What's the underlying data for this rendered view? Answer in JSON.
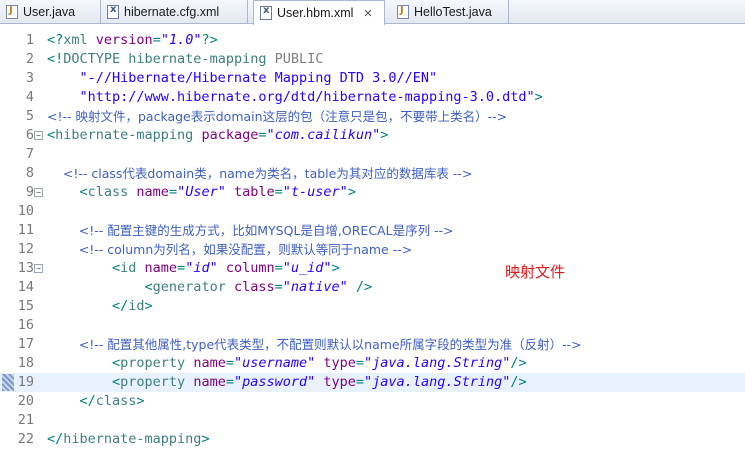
{
  "tabs": [
    {
      "label": "User.java",
      "icon": "java-file-icon"
    },
    {
      "label": "hibernate.cfg.xml",
      "icon": "xml-file-icon"
    },
    {
      "label": "User.hbm.xml",
      "icon": "xml-file-icon",
      "active": true,
      "close_glyph": "✕"
    },
    {
      "label": "HelloTest.java",
      "icon": "java-file-icon"
    }
  ],
  "editor": {
    "current_line": 19,
    "lines": [
      {
        "n": "1",
        "segs": [
          [
            "p",
            "<?"
          ],
          [
            "t",
            "xml "
          ],
          [
            "a",
            "version"
          ],
          [
            "p",
            "="
          ],
          [
            "v",
            "\"1.0\""
          ],
          [
            "p",
            "?>"
          ]
        ]
      },
      {
        "n": "2",
        "segs": [
          [
            "p",
            "<!"
          ],
          [
            "t",
            "DOCTYPE hibernate-mapping "
          ],
          [
            "d",
            "PUBLIC"
          ]
        ]
      },
      {
        "n": "3",
        "segs": [
          [
            "s",
            "    \"-//Hibernate/Hibernate Mapping DTD 3.0//EN\""
          ]
        ]
      },
      {
        "n": "4",
        "segs": [
          [
            "s",
            "    \"http://www.hibernate.org/dtd/hibernate-mapping-3.0.dtd\""
          ],
          [
            "p",
            ">"
          ]
        ]
      },
      {
        "n": "5",
        "segs": [
          [
            "c",
            "<!-- 映射文件，package表示domain这层的包（注意只是包，不要带上类名）-->"
          ]
        ]
      },
      {
        "n": "6",
        "fold": true,
        "segs": [
          [
            "p",
            "<"
          ],
          [
            "t",
            "hibernate-mapping "
          ],
          [
            "a",
            "package"
          ],
          [
            "p",
            "="
          ],
          [
            "v",
            "\"com.cailikun\""
          ],
          [
            "p",
            ">"
          ]
        ]
      },
      {
        "n": "7",
        "segs": []
      },
      {
        "n": "8",
        "segs": [
          [
            "c",
            "    <!-- class代表domain类，name为类名，table为其对应的数据库表 -->"
          ]
        ]
      },
      {
        "n": "9",
        "fold": true,
        "segs": [
          [
            "p",
            "    <"
          ],
          [
            "t",
            "class "
          ],
          [
            "a",
            "name"
          ],
          [
            "p",
            "="
          ],
          [
            "v",
            "\"User\""
          ],
          [
            "t",
            " "
          ],
          [
            "a",
            "table"
          ],
          [
            "p",
            "="
          ],
          [
            "v",
            "\"t-user\""
          ],
          [
            "p",
            ">"
          ]
        ]
      },
      {
        "n": "10",
        "segs": []
      },
      {
        "n": "11",
        "segs": [
          [
            "c",
            "        <!-- 配置主键的生成方式，比如MYSQL是自增,ORECAL是序列 -->"
          ]
        ]
      },
      {
        "n": "12",
        "segs": [
          [
            "c",
            "        <!-- column为列名，如果没配置，则默认等同于name -->"
          ]
        ]
      },
      {
        "n": "13",
        "fold": true,
        "segs": [
          [
            "p",
            "        <"
          ],
          [
            "t",
            "id "
          ],
          [
            "a",
            "name"
          ],
          [
            "p",
            "="
          ],
          [
            "v",
            "\"id\""
          ],
          [
            "t",
            " "
          ],
          [
            "a",
            "column"
          ],
          [
            "p",
            "="
          ],
          [
            "v",
            "\"u_id\""
          ],
          [
            "p",
            ">"
          ]
        ]
      },
      {
        "n": "14",
        "segs": [
          [
            "p",
            "            <"
          ],
          [
            "t",
            "generator "
          ],
          [
            "a",
            "class"
          ],
          [
            "p",
            "="
          ],
          [
            "v",
            "\"native\""
          ],
          [
            "t",
            " "
          ],
          [
            "p",
            "/>"
          ]
        ]
      },
      {
        "n": "15",
        "segs": [
          [
            "p",
            "        </"
          ],
          [
            "t",
            "id"
          ],
          [
            "p",
            ">"
          ]
        ]
      },
      {
        "n": "16",
        "segs": []
      },
      {
        "n": "17",
        "segs": [
          [
            "c",
            "        <!-- 配置其他属性,type代表类型，不配置则默认以name所属字段的类型为准（反射）-->"
          ]
        ]
      },
      {
        "n": "18",
        "segs": [
          [
            "p",
            "        <"
          ],
          [
            "t",
            "property "
          ],
          [
            "a",
            "name"
          ],
          [
            "p",
            "="
          ],
          [
            "v",
            "\"username\""
          ],
          [
            "t",
            " "
          ],
          [
            "a",
            "type"
          ],
          [
            "p",
            "="
          ],
          [
            "v",
            "\"java.lang.String\""
          ],
          [
            "p",
            "/>"
          ]
        ]
      },
      {
        "n": "19",
        "segs": [
          [
            "p",
            "        <"
          ],
          [
            "t",
            "property "
          ],
          [
            "a",
            "name"
          ],
          [
            "p",
            "="
          ],
          [
            "v",
            "\"password\""
          ],
          [
            "t",
            " "
          ],
          [
            "a",
            "type"
          ],
          [
            "p",
            "="
          ],
          [
            "v",
            "\"java.lang.String\""
          ],
          [
            "p",
            "/>"
          ]
        ]
      },
      {
        "n": "20",
        "segs": [
          [
            "p",
            "    </"
          ],
          [
            "t",
            "class"
          ],
          [
            "p",
            ">"
          ]
        ]
      },
      {
        "n": "21",
        "segs": []
      },
      {
        "n": "22",
        "segs": [
          [
            "p",
            "</"
          ],
          [
            "t",
            "hibernate-mapping"
          ],
          [
            "p",
            ">"
          ]
        ]
      }
    ]
  },
  "annotation": "映射文件",
  "colors": {
    "punct": "#008080",
    "tag": "#3f7f7f",
    "attr": "#7f007f",
    "value": "#2a00ff",
    "comment": "#3f5fbf",
    "annotation": "#e0191d",
    "current_line": "#e8f2fe"
  }
}
